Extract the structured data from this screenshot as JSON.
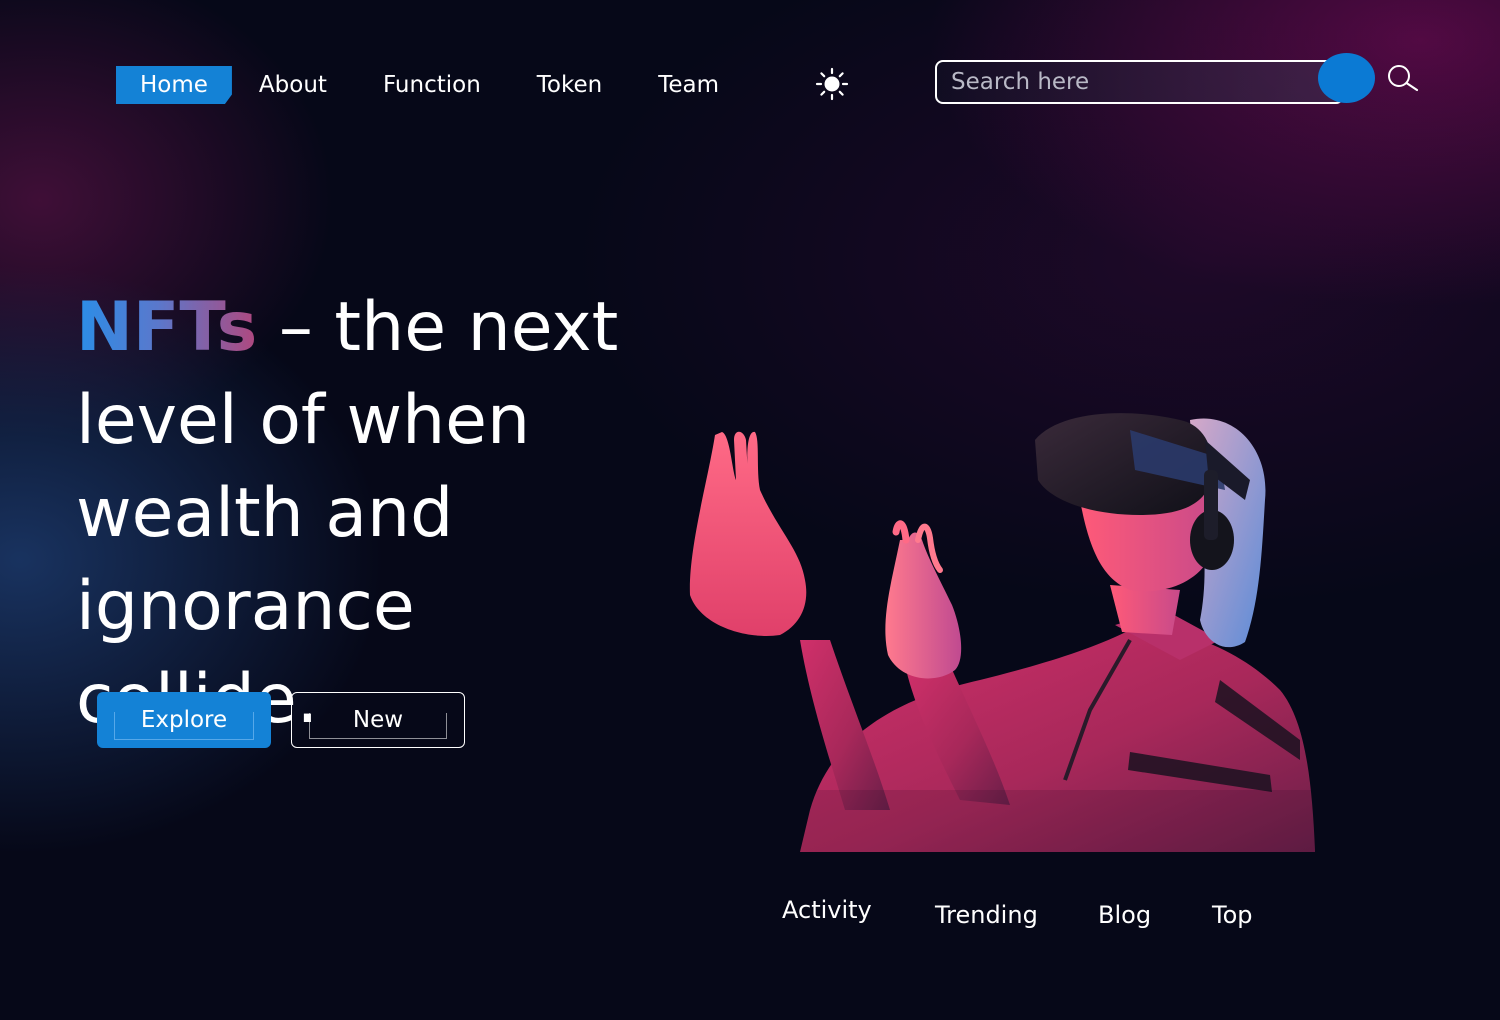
{
  "nav": {
    "items": [
      {
        "label": "Home",
        "active": true
      },
      {
        "label": "About",
        "active": false
      },
      {
        "label": "Function",
        "active": false
      },
      {
        "label": "Token",
        "active": false
      },
      {
        "label": "Team",
        "active": false
      }
    ],
    "theme_icon": "sun-icon"
  },
  "search": {
    "placeholder": "Search here",
    "value": "",
    "icon": "search-icon"
  },
  "hero": {
    "heading_accent": "NFTs",
    "heading_rest": " – the next level of when wealth and ignorance collide.",
    "buttons": {
      "explore": "Explore",
      "new": "New"
    }
  },
  "bottom_links": [
    "Activity",
    "Trending",
    "Blog",
    "Top"
  ],
  "colors": {
    "background": "#060818",
    "accent_blue": "#1482d6",
    "gradient_start": "#2a8ee8",
    "gradient_end": "#b0487e",
    "text": "#ffffff"
  }
}
